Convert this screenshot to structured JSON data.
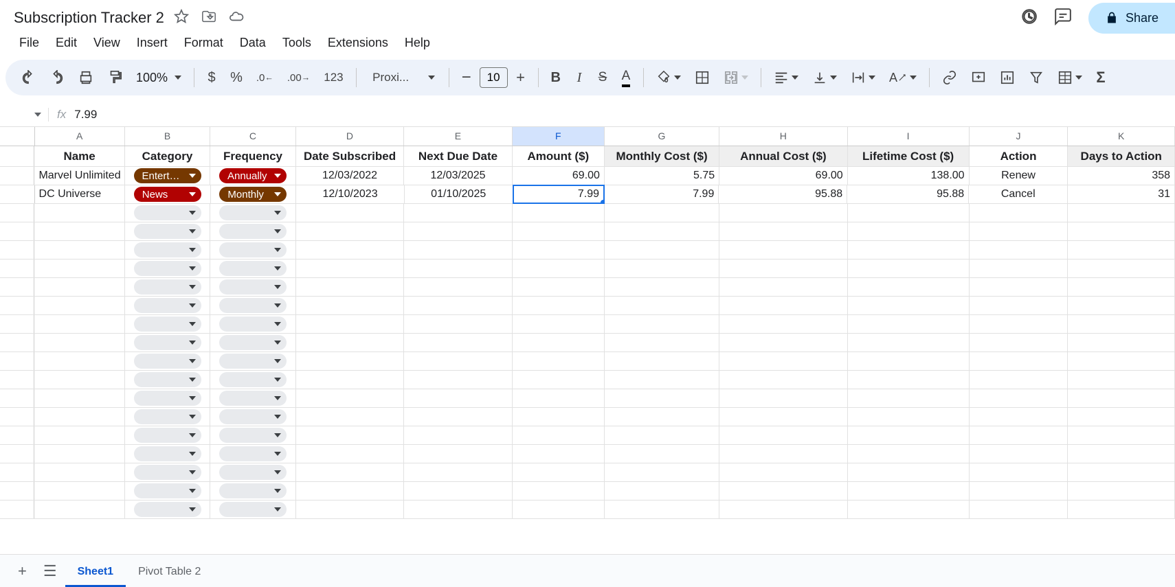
{
  "title": "Subscription Tracker 2",
  "menus": [
    "File",
    "Edit",
    "View",
    "Insert",
    "Format",
    "Data",
    "Tools",
    "Extensions",
    "Help"
  ],
  "share_label": "Share",
  "zoom": "100%",
  "font_name": "Proxi...",
  "font_size": "10",
  "formula_value": "7.99",
  "currency_123": "123",
  "columns": [
    "A",
    "B",
    "C",
    "D",
    "E",
    "F",
    "G",
    "H",
    "I",
    "J",
    "K"
  ],
  "selected_col": "F",
  "headers": {
    "A": "Name",
    "B": "Category",
    "C": "Frequency",
    "D": "Date Subscribed",
    "E": "Next Due Date",
    "F": "Amount ($)",
    "G": "Monthly Cost ($)",
    "H": "Annual Cost ($)",
    "I": "Lifetime Cost ($)",
    "J": "Action",
    "K": "Days to Action"
  },
  "grey_headers": [
    "G",
    "H",
    "I",
    "K"
  ],
  "rows": [
    {
      "A": "Marvel Unlimited",
      "B": {
        "text": "Entertai...",
        "color": "brown"
      },
      "C": {
        "text": "Annually",
        "color": "red"
      },
      "D": "12/03/2022",
      "E": "12/03/2025",
      "F": "69.00",
      "G": "5.75",
      "H": "69.00",
      "I": "138.00",
      "J": "Renew",
      "K": "358"
    },
    {
      "A": "DC Universe",
      "B": {
        "text": "News",
        "color": "red"
      },
      "C": {
        "text": "Monthly",
        "color": "brown"
      },
      "D": "12/10/2023",
      "E": "01/10/2025",
      "F": "7.99",
      "G": "7.99",
      "H": "95.88",
      "I": "95.88",
      "J": "Cancel",
      "K": "31"
    }
  ],
  "selected_cell": {
    "row": 1,
    "col": "F"
  },
  "empty_rows": 17,
  "tabs": [
    {
      "label": "Sheet1",
      "active": true
    },
    {
      "label": "Pivot Table 2",
      "active": false
    }
  ]
}
